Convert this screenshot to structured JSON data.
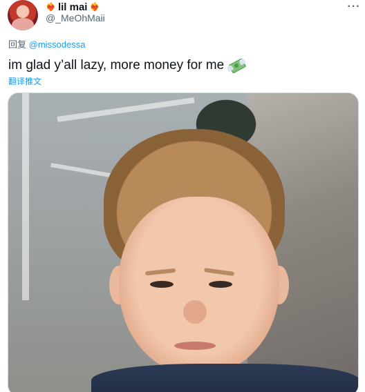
{
  "tweet": {
    "display_name": "lil mai",
    "name_emoji_left": "❤‍🔥",
    "name_emoji_right": "❤‍🔥",
    "handle": "@_MeOhMaii",
    "more_label": "···",
    "reply_prefix": "回复",
    "reply_mention": "@missodessa",
    "text": "im glad y’all lazy, more money for me",
    "emoji": "money-with-wings",
    "translate_label": "翻译推文"
  },
  "colors": {
    "accent": "#1d9bf0",
    "text_primary": "#0f1419",
    "text_secondary": "#536471",
    "border": "#cfd9de"
  }
}
